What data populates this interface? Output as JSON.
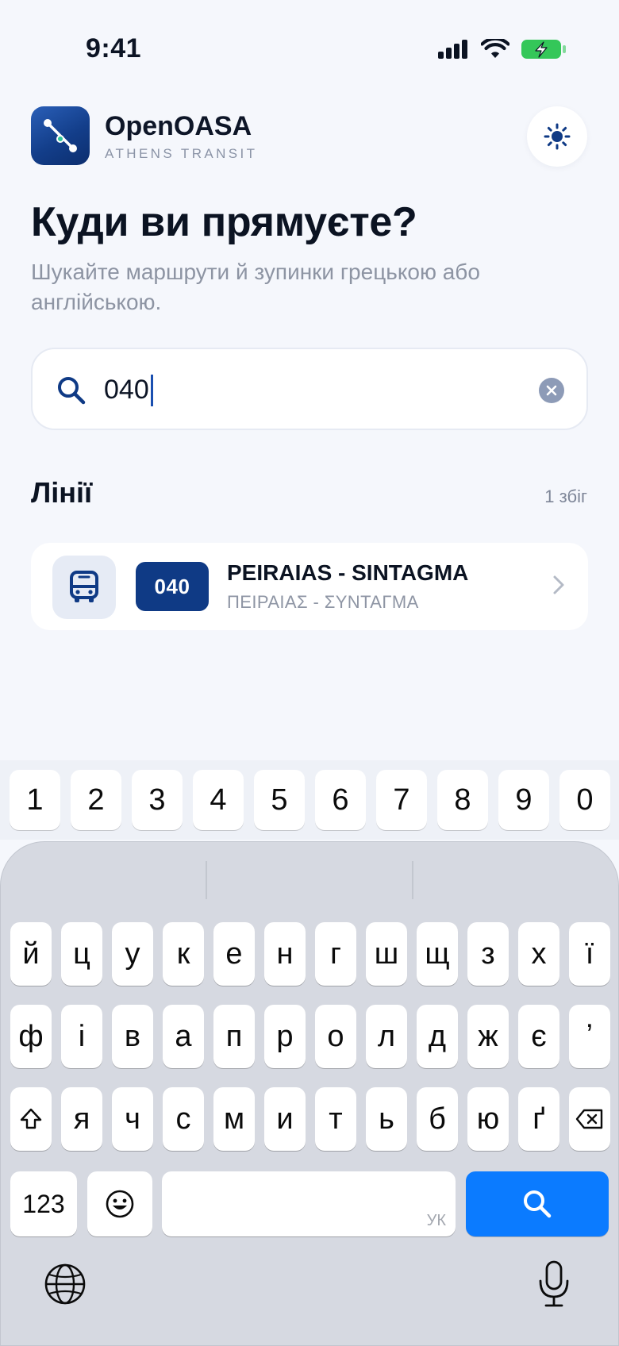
{
  "status": {
    "time": "9:41"
  },
  "header": {
    "app_name": "OpenOASA",
    "tagline": "ATHENS TRANSIT"
  },
  "page": {
    "title": "Куди ви прямуєте?",
    "subtitle": "Шукайте маршрути й зупинки грецькою або англійською."
  },
  "search": {
    "value": "040",
    "placeholder": ""
  },
  "section": {
    "title": "Лінії",
    "count": "1 збіг"
  },
  "results": [
    {
      "line": "040",
      "name": "PEIRAIAS - SINTAGMA",
      "name_greek": "ΠΕΙΡΑΙΑΣ - ΣΥΝΤΑΓΜΑ"
    }
  ],
  "keyboard": {
    "number_row": [
      "1",
      "2",
      "3",
      "4",
      "5",
      "6",
      "7",
      "8",
      "9",
      "0"
    ],
    "row1": [
      "й",
      "ц",
      "у",
      "к",
      "е",
      "н",
      "г",
      "ш",
      "щ",
      "з",
      "х",
      "ї"
    ],
    "row2": [
      "ф",
      "і",
      "в",
      "а",
      "п",
      "р",
      "о",
      "л",
      "д",
      "ж",
      "є",
      "ʼ"
    ],
    "row3": [
      "я",
      "ч",
      "с",
      "м",
      "и",
      "т",
      "ь",
      "б",
      "ю",
      "ґ"
    ],
    "numbers_key": "123",
    "space_lang": "УК"
  },
  "colors": {
    "brand": "#0f3a85",
    "accent_blue": "#0b7bff",
    "battery_green": "#34c759"
  }
}
